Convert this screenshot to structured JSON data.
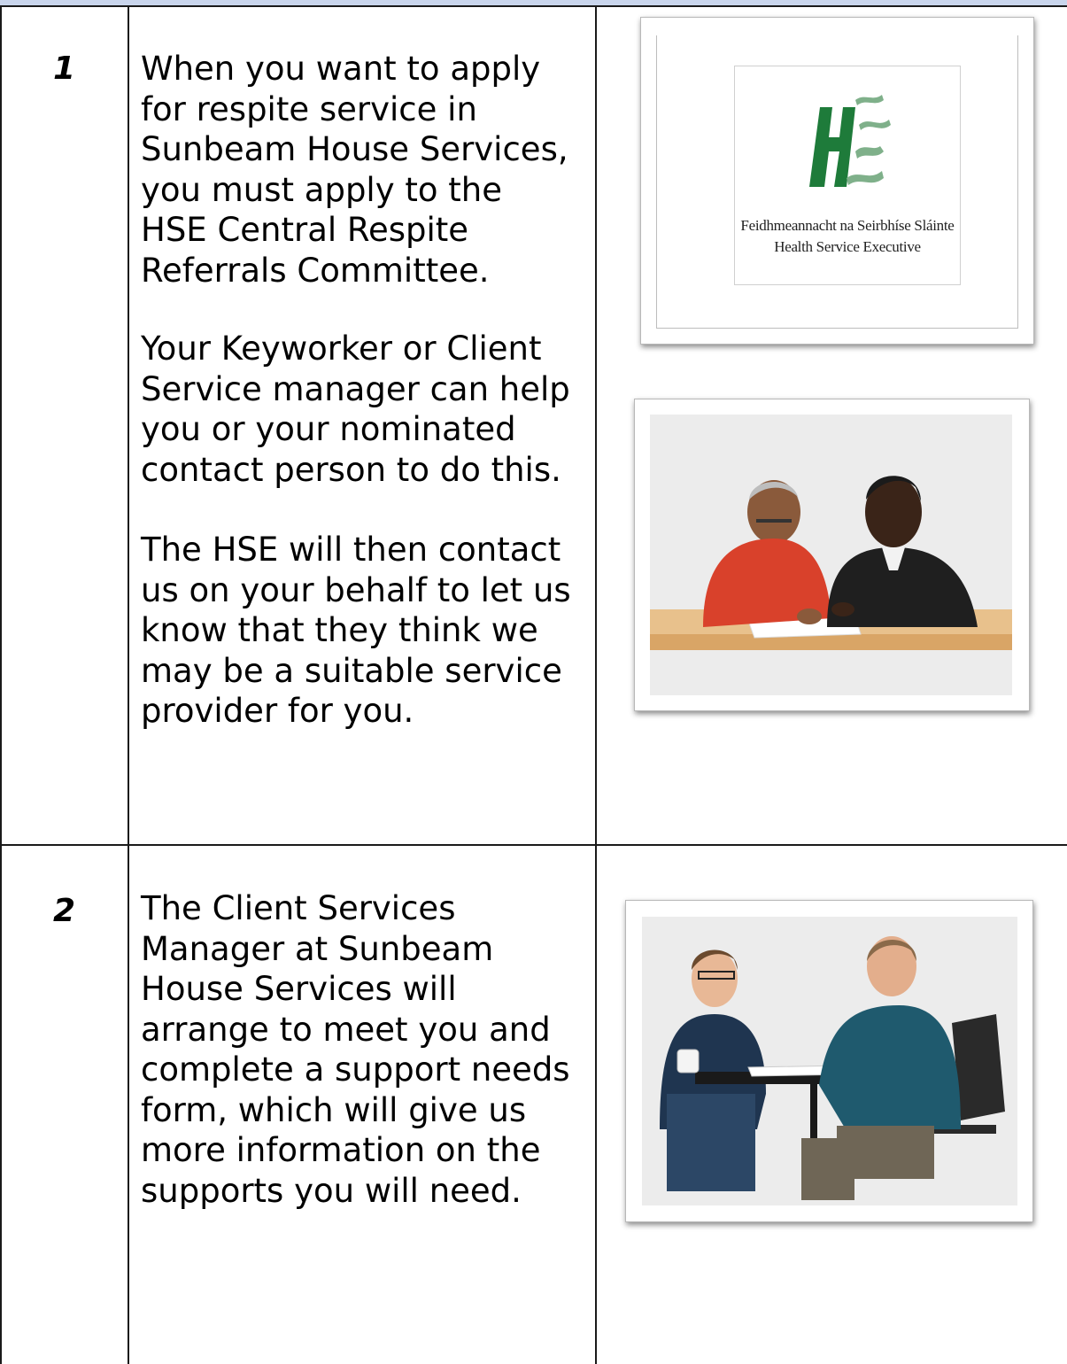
{
  "steps": [
    {
      "number": "1",
      "paragraphs": [
        "When you want to apply\nfor respite service in\nSunbeam House Services,\nyou must apply to the\nHSE Central Respite\nReferrals Committee.",
        " Your Keyworker or Client\nService manager can help\nyou or your nominated\ncontact person to do this.",
        "The HSE will then contact\nus on your behalf to let us\nknow that they think we\nmay be a suitable service\nprovider for you."
      ],
      "logo": {
        "name_irish": "Feidhmeannacht na Seirbhíse Sláinte",
        "name_english": "Health Service Executive",
        "brand_green": "#1e7b3a"
      }
    },
    {
      "number": "2",
      "paragraphs": [
        "The Client Services\nManager at Sunbeam\nHouse Services will\narrange to meet you and\ncomplete a support needs\nform, which will give us\nmore information on the\nsupports you will need."
      ]
    }
  ],
  "colors": {
    "header_band": "#c9d5ec",
    "grid_lines": "#1a1a1a"
  }
}
